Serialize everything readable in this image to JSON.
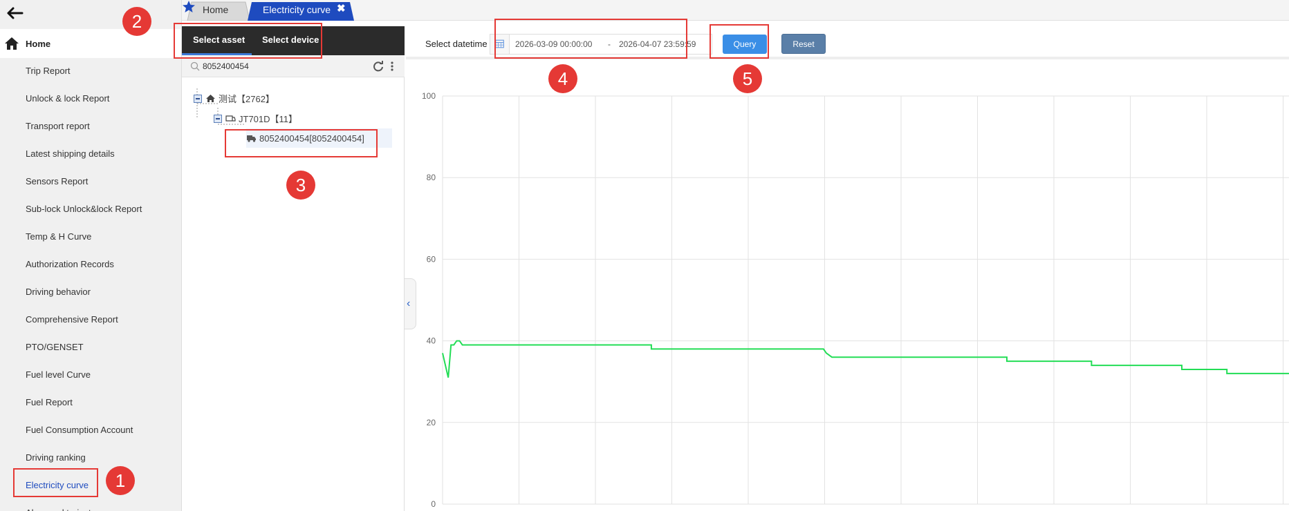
{
  "sidebar": {
    "home_label": "Home",
    "items": [
      {
        "label": "Trip Report"
      },
      {
        "label": "Unlock & lock Report"
      },
      {
        "label": "Transport report"
      },
      {
        "label": "Latest shipping details"
      },
      {
        "label": "Sensors Report"
      },
      {
        "label": "Sub-lock Unlock&lock Report"
      },
      {
        "label": "Temp & H Curve"
      },
      {
        "label": "Authorization Records"
      },
      {
        "label": "Driving behavior"
      },
      {
        "label": "Comprehensive Report"
      },
      {
        "label": "PTO/GENSET"
      },
      {
        "label": "Fuel level Curve"
      },
      {
        "label": "Fuel Report"
      },
      {
        "label": "Fuel Consumption Account"
      },
      {
        "label": "Driving ranking"
      },
      {
        "label": "Electricity curve",
        "active": true
      },
      {
        "label": "Abnormal trajectory"
      }
    ]
  },
  "tabs": [
    {
      "label": "Home"
    },
    {
      "label": "Electricity curve",
      "active": true
    }
  ],
  "panel": {
    "tab_asset": "Select asset",
    "tab_device": "Select device",
    "search_value": "8052400454",
    "tree": {
      "root": "测试【2762】",
      "group": "JT701D【11】",
      "device": "8052400454[8052400454]"
    }
  },
  "filter": {
    "label": "Select datetime",
    "start": "2026-03-09 00:00:00",
    "separator": "-",
    "end": "2026-04-07 23:59:59",
    "query_label": "Query",
    "reset_label": "Reset"
  },
  "annotations": [
    "1",
    "2",
    "3",
    "4",
    "5"
  ],
  "colors": {
    "accent": "#1e4bbf",
    "line": "#22dd55",
    "annotation": "#e53935",
    "query": "#3a8ee6",
    "reset": "#5a7fa8"
  },
  "chart_data": {
    "type": "line",
    "yticks": [
      "0",
      "20",
      "40",
      "60",
      "80",
      "100"
    ],
    "ylim": [
      0,
      100
    ],
    "grid": true,
    "xlim": [
      0,
      30
    ],
    "series": [
      {
        "x": [
          0,
          0.2,
          0.3,
          0.4,
          0.5,
          0.6,
          0.7,
          0.8,
          1.0,
          7.4,
          7.4,
          13.5,
          13.6,
          13.8,
          20.0,
          20.0,
          23.0,
          23.0,
          26.2,
          26.2,
          27.8,
          27.8,
          30
        ],
        "y": [
          37,
          31,
          39,
          39,
          40,
          40,
          39,
          39,
          39,
          39,
          38,
          38,
          37,
          36,
          36,
          35,
          35,
          34,
          34,
          33,
          33,
          32,
          32
        ]
      }
    ]
  }
}
